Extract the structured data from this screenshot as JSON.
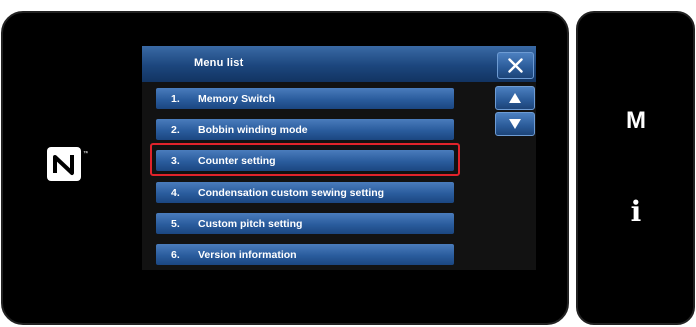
{
  "menu": {
    "title": "Menu list",
    "close_icon": "close-x-icon",
    "scroll_up_icon": "triangle-up-icon",
    "scroll_down_icon": "triangle-down-icon",
    "selected_index": 2,
    "items": [
      {
        "number": "1.",
        "label": "Memory Switch"
      },
      {
        "number": "2.",
        "label": "Bobbin winding mode"
      },
      {
        "number": "3.",
        "label": "Counter setting"
      },
      {
        "number": "4.",
        "label": "Condensation custom sewing setting"
      },
      {
        "number": "5.",
        "label": "Custom pitch setting"
      },
      {
        "number": "6.",
        "label": "Version information"
      }
    ]
  },
  "side_keys": {
    "menu_key": "M",
    "info_key": "i"
  },
  "icons": {
    "nfc": "nfc-icon"
  },
  "colors": {
    "highlight_border": "#e0232b",
    "button_blue": "#2a5c9d",
    "screen_bg": "#000000"
  }
}
